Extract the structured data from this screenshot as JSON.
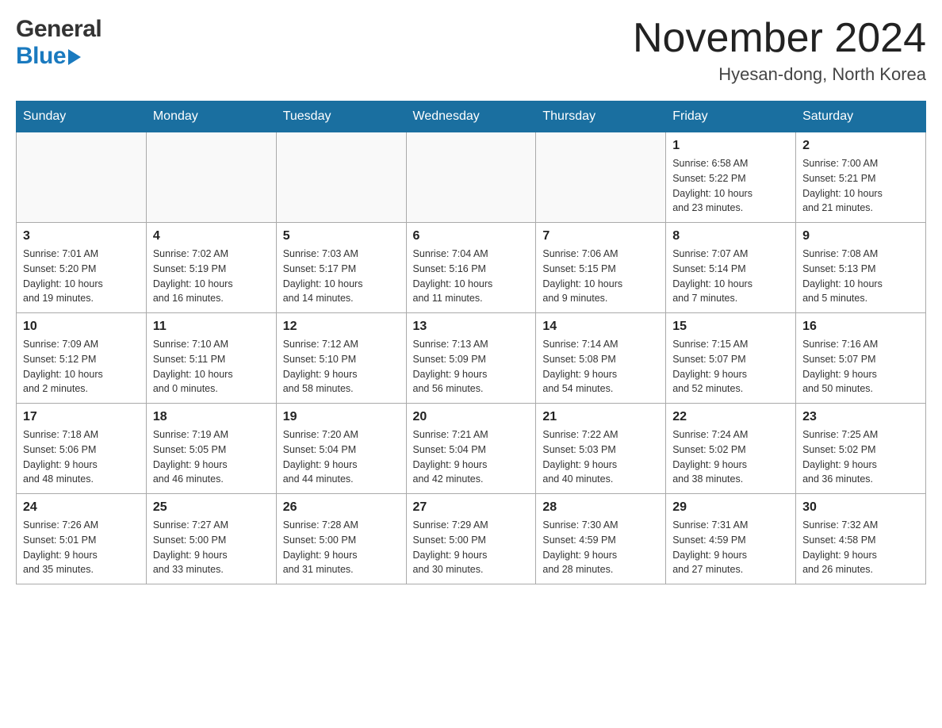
{
  "header": {
    "logo_line1": "General",
    "logo_line2": "Blue",
    "month_title": "November 2024",
    "location": "Hyesan-dong, North Korea"
  },
  "weekdays": [
    "Sunday",
    "Monday",
    "Tuesday",
    "Wednesday",
    "Thursday",
    "Friday",
    "Saturday"
  ],
  "weeks": [
    {
      "days": [
        {
          "number": "",
          "info": ""
        },
        {
          "number": "",
          "info": ""
        },
        {
          "number": "",
          "info": ""
        },
        {
          "number": "",
          "info": ""
        },
        {
          "number": "",
          "info": ""
        },
        {
          "number": "1",
          "info": "Sunrise: 6:58 AM\nSunset: 5:22 PM\nDaylight: 10 hours\nand 23 minutes."
        },
        {
          "number": "2",
          "info": "Sunrise: 7:00 AM\nSunset: 5:21 PM\nDaylight: 10 hours\nand 21 minutes."
        }
      ]
    },
    {
      "days": [
        {
          "number": "3",
          "info": "Sunrise: 7:01 AM\nSunset: 5:20 PM\nDaylight: 10 hours\nand 19 minutes."
        },
        {
          "number": "4",
          "info": "Sunrise: 7:02 AM\nSunset: 5:19 PM\nDaylight: 10 hours\nand 16 minutes."
        },
        {
          "number": "5",
          "info": "Sunrise: 7:03 AM\nSunset: 5:17 PM\nDaylight: 10 hours\nand 14 minutes."
        },
        {
          "number": "6",
          "info": "Sunrise: 7:04 AM\nSunset: 5:16 PM\nDaylight: 10 hours\nand 11 minutes."
        },
        {
          "number": "7",
          "info": "Sunrise: 7:06 AM\nSunset: 5:15 PM\nDaylight: 10 hours\nand 9 minutes."
        },
        {
          "number": "8",
          "info": "Sunrise: 7:07 AM\nSunset: 5:14 PM\nDaylight: 10 hours\nand 7 minutes."
        },
        {
          "number": "9",
          "info": "Sunrise: 7:08 AM\nSunset: 5:13 PM\nDaylight: 10 hours\nand 5 minutes."
        }
      ]
    },
    {
      "days": [
        {
          "number": "10",
          "info": "Sunrise: 7:09 AM\nSunset: 5:12 PM\nDaylight: 10 hours\nand 2 minutes."
        },
        {
          "number": "11",
          "info": "Sunrise: 7:10 AM\nSunset: 5:11 PM\nDaylight: 10 hours\nand 0 minutes."
        },
        {
          "number": "12",
          "info": "Sunrise: 7:12 AM\nSunset: 5:10 PM\nDaylight: 9 hours\nand 58 minutes."
        },
        {
          "number": "13",
          "info": "Sunrise: 7:13 AM\nSunset: 5:09 PM\nDaylight: 9 hours\nand 56 minutes."
        },
        {
          "number": "14",
          "info": "Sunrise: 7:14 AM\nSunset: 5:08 PM\nDaylight: 9 hours\nand 54 minutes."
        },
        {
          "number": "15",
          "info": "Sunrise: 7:15 AM\nSunset: 5:07 PM\nDaylight: 9 hours\nand 52 minutes."
        },
        {
          "number": "16",
          "info": "Sunrise: 7:16 AM\nSunset: 5:07 PM\nDaylight: 9 hours\nand 50 minutes."
        }
      ]
    },
    {
      "days": [
        {
          "number": "17",
          "info": "Sunrise: 7:18 AM\nSunset: 5:06 PM\nDaylight: 9 hours\nand 48 minutes."
        },
        {
          "number": "18",
          "info": "Sunrise: 7:19 AM\nSunset: 5:05 PM\nDaylight: 9 hours\nand 46 minutes."
        },
        {
          "number": "19",
          "info": "Sunrise: 7:20 AM\nSunset: 5:04 PM\nDaylight: 9 hours\nand 44 minutes."
        },
        {
          "number": "20",
          "info": "Sunrise: 7:21 AM\nSunset: 5:04 PM\nDaylight: 9 hours\nand 42 minutes."
        },
        {
          "number": "21",
          "info": "Sunrise: 7:22 AM\nSunset: 5:03 PM\nDaylight: 9 hours\nand 40 minutes."
        },
        {
          "number": "22",
          "info": "Sunrise: 7:24 AM\nSunset: 5:02 PM\nDaylight: 9 hours\nand 38 minutes."
        },
        {
          "number": "23",
          "info": "Sunrise: 7:25 AM\nSunset: 5:02 PM\nDaylight: 9 hours\nand 36 minutes."
        }
      ]
    },
    {
      "days": [
        {
          "number": "24",
          "info": "Sunrise: 7:26 AM\nSunset: 5:01 PM\nDaylight: 9 hours\nand 35 minutes."
        },
        {
          "number": "25",
          "info": "Sunrise: 7:27 AM\nSunset: 5:00 PM\nDaylight: 9 hours\nand 33 minutes."
        },
        {
          "number": "26",
          "info": "Sunrise: 7:28 AM\nSunset: 5:00 PM\nDaylight: 9 hours\nand 31 minutes."
        },
        {
          "number": "27",
          "info": "Sunrise: 7:29 AM\nSunset: 5:00 PM\nDaylight: 9 hours\nand 30 minutes."
        },
        {
          "number": "28",
          "info": "Sunrise: 7:30 AM\nSunset: 4:59 PM\nDaylight: 9 hours\nand 28 minutes."
        },
        {
          "number": "29",
          "info": "Sunrise: 7:31 AM\nSunset: 4:59 PM\nDaylight: 9 hours\nand 27 minutes."
        },
        {
          "number": "30",
          "info": "Sunrise: 7:32 AM\nSunset: 4:58 PM\nDaylight: 9 hours\nand 26 minutes."
        }
      ]
    }
  ]
}
